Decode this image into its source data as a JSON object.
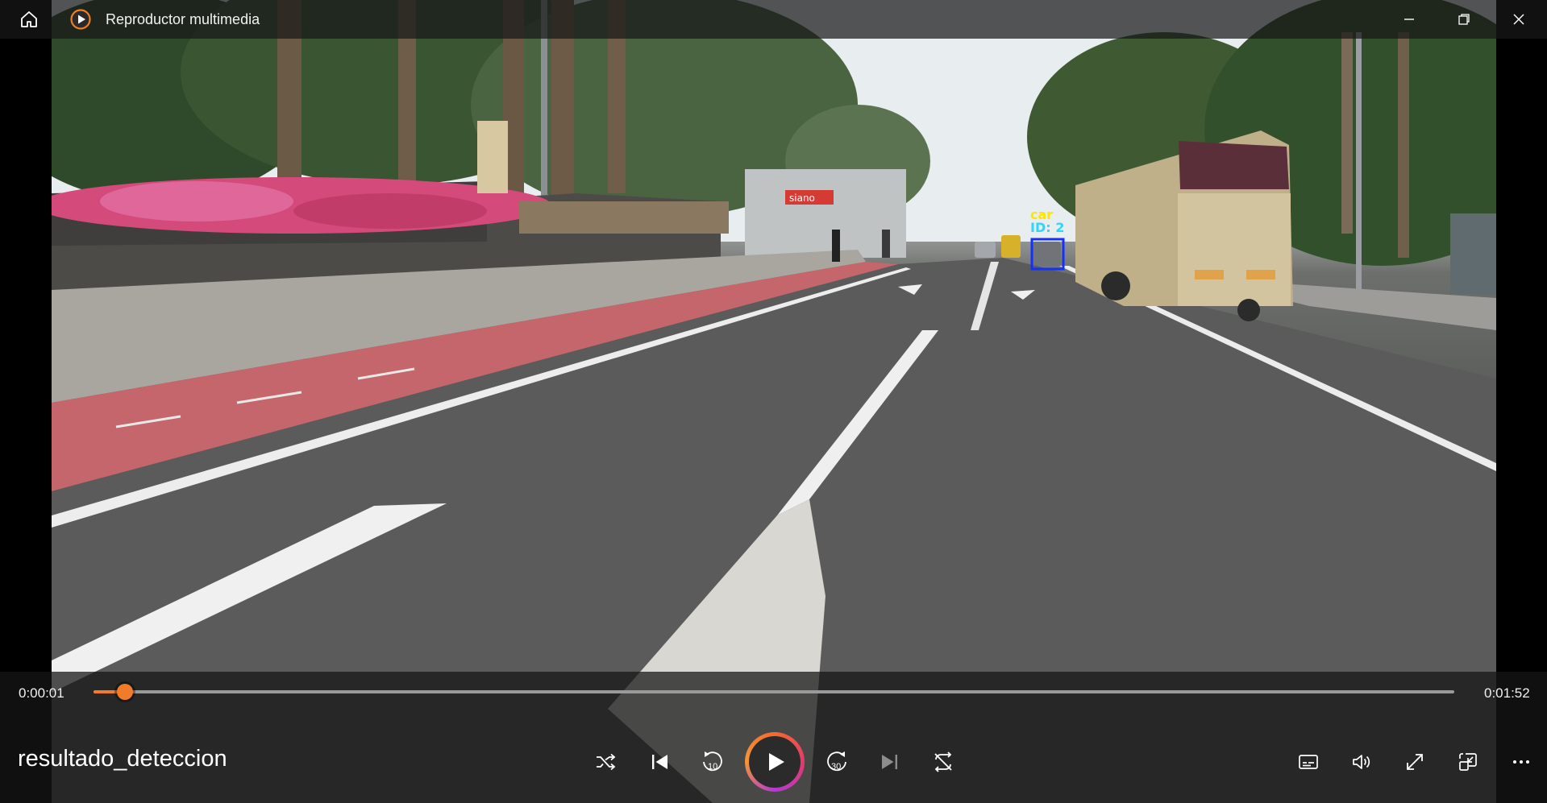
{
  "window": {
    "title": "Reproductor multimedia",
    "icons": {
      "home": "home-icon",
      "app": "media-player-app-icon",
      "minimize": "minimize-icon",
      "maximize": "maximize-icon",
      "close": "close-icon"
    }
  },
  "video": {
    "detection": {
      "label": "car",
      "id_label": "ID: 2"
    },
    "shop_sign": "siano",
    "colors": {
      "label": "#ffe400",
      "id": "#29d7ff",
      "box": "#1430ff"
    }
  },
  "playback": {
    "current_time": "0:00:01",
    "total_time": "0:01:52",
    "progress_fraction": 0.009,
    "media_name": "resultado_deteccion"
  },
  "controls": {
    "shuffle": "shuffle-icon",
    "previous": "previous-icon",
    "rewind": "10",
    "play": "play-icon",
    "forward": "30",
    "next": "next-icon",
    "repeat": "repeat-off-icon",
    "subtitles": "subtitles-icon",
    "volume": "volume-icon",
    "fullscreen": "fullscreen-icon",
    "miniplayer": "miniplayer-icon",
    "more": "more-options-icon"
  },
  "colors": {
    "accent": "#f07c2a",
    "accent_gradient_end": "#b13ad1",
    "bar_background": "#181818"
  }
}
